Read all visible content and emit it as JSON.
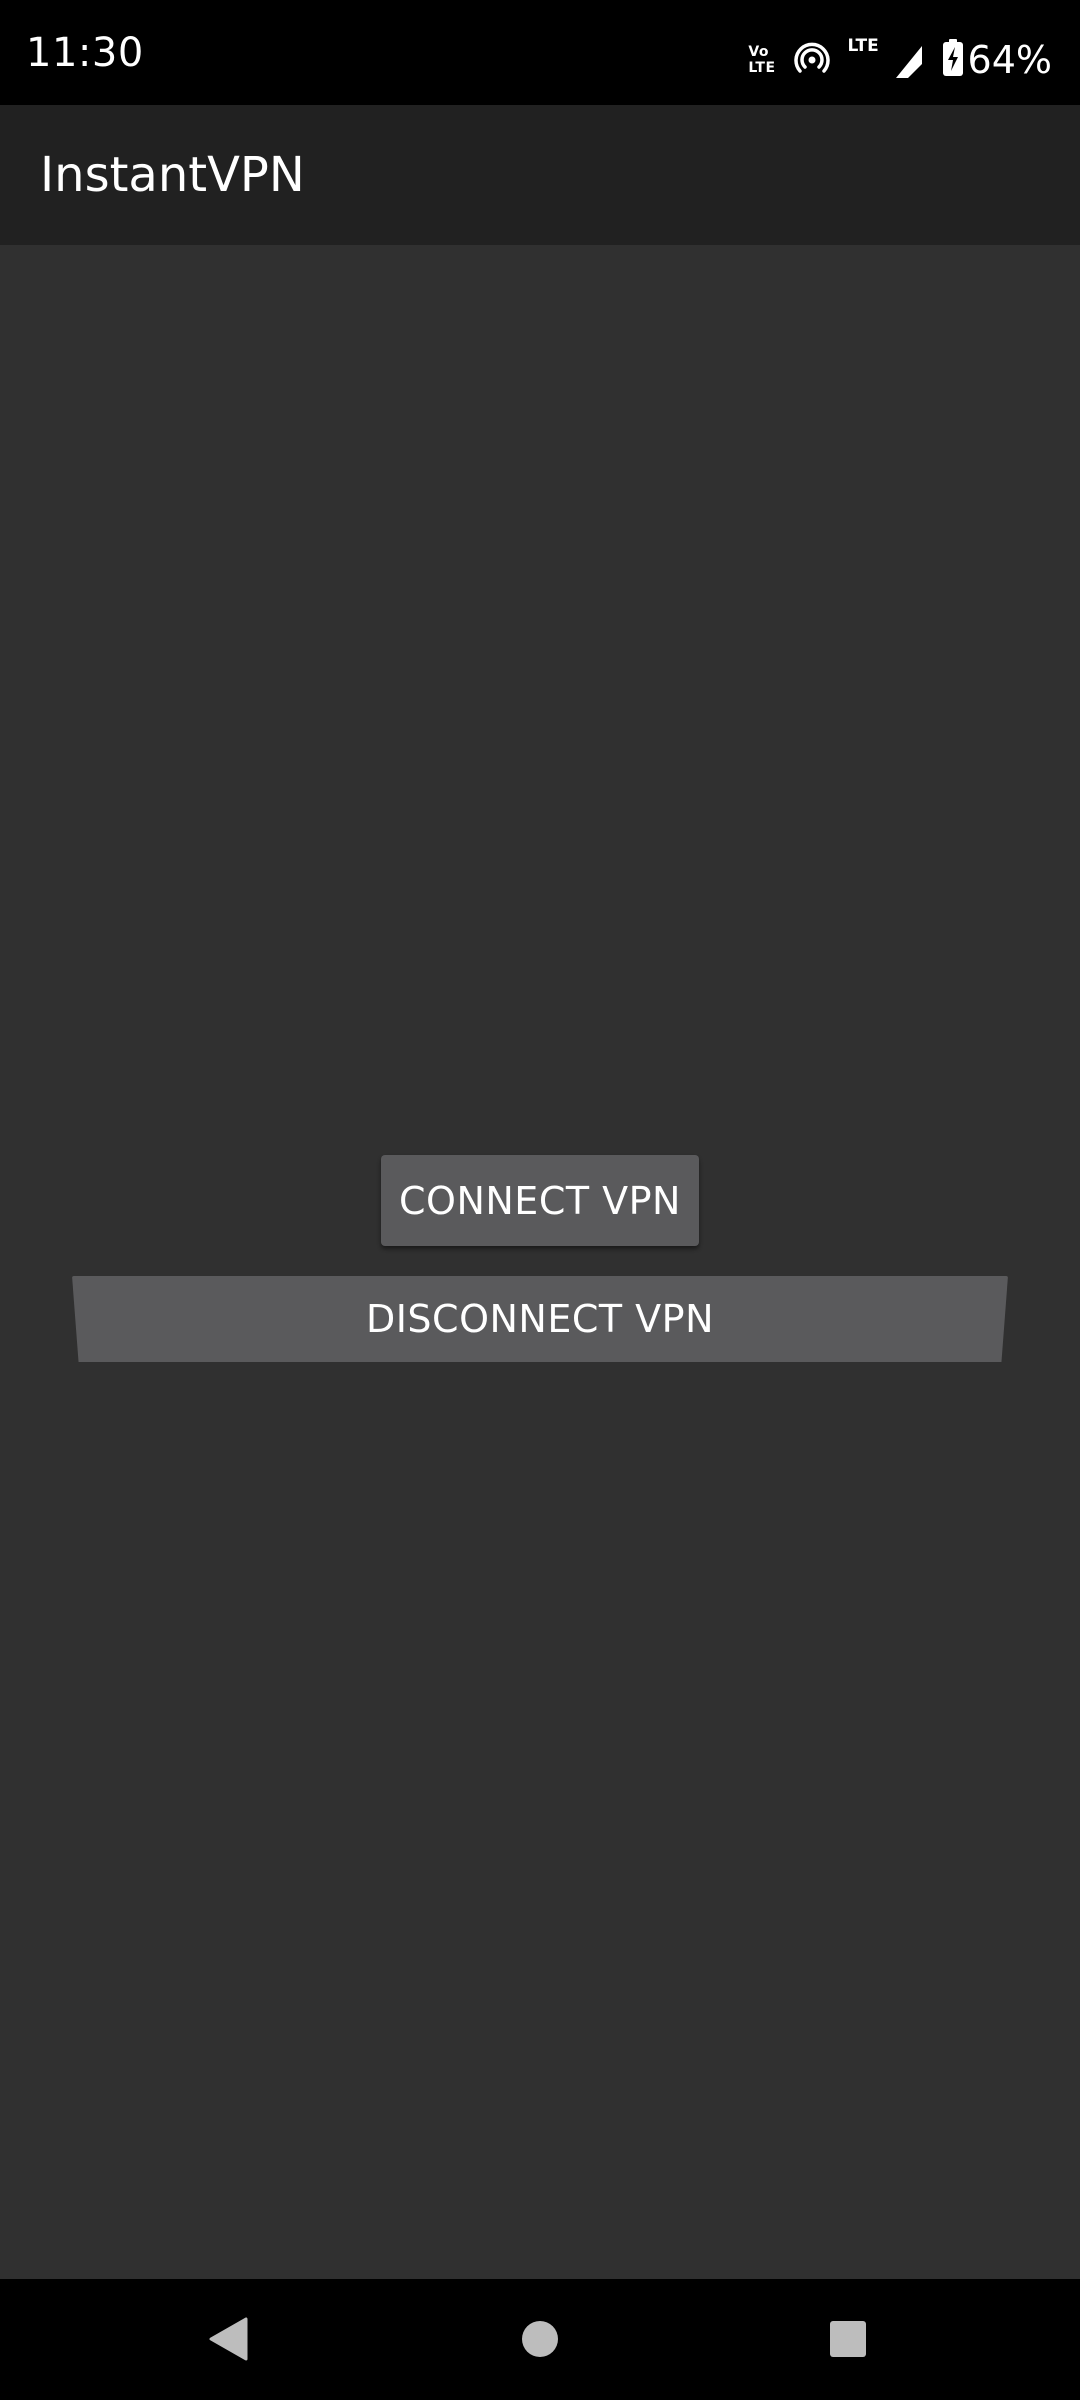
{
  "status_bar": {
    "time": "11:30",
    "volte_top": "Vo",
    "volte_bottom": "LTE",
    "lte_label": "LTE",
    "battery_percent": "64%",
    "icons": [
      "volte-icon",
      "hotspot-icon",
      "lte-signal-icon",
      "battery-charging-icon"
    ]
  },
  "app_bar": {
    "title": "InstantVPN"
  },
  "buttons": {
    "connect_label": "CONNECT VPN",
    "disconnect_label": "DISCONNECT VPN"
  },
  "nav_bar": {
    "icons": [
      "back-icon",
      "home-icon",
      "recents-icon"
    ]
  },
  "colors": {
    "status_bar_bg": "#000000",
    "app_bar_bg": "#212121",
    "content_bg": "#303030",
    "button_bg": "#5a5a5c",
    "nav_icon": "#bdbdbd"
  }
}
